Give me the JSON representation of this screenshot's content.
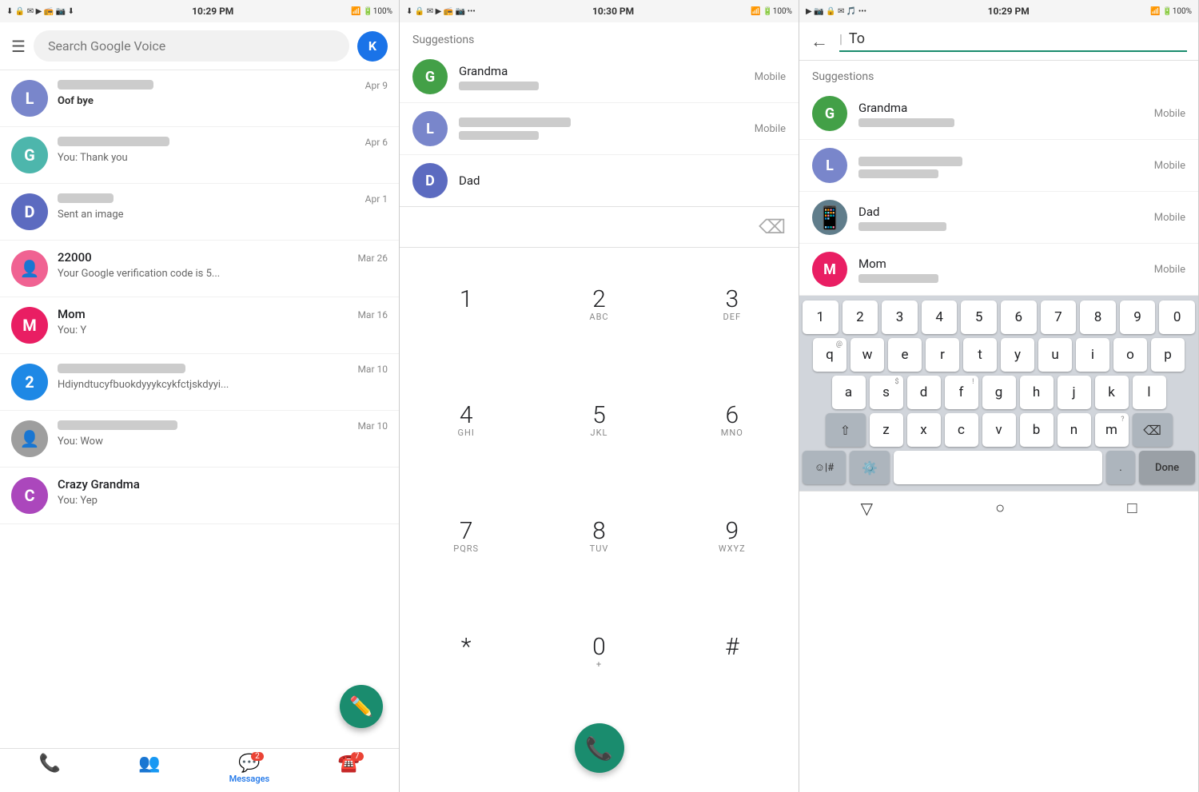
{
  "panel1": {
    "status": {
      "time": "10:29 PM",
      "battery": "100%"
    },
    "search_placeholder": "Search Google Voice",
    "avatar_label": "K",
    "conversations": [
      {
        "id": "L",
        "color": "#7986cb",
        "name": "Oof bye",
        "name_bold": true,
        "preview": "Oof bye",
        "date": "Apr 9",
        "preview_blurred": true,
        "preview_text": ""
      },
      {
        "id": "G",
        "color": "#4db6ac",
        "name": "",
        "name_bold": false,
        "preview": "You: Thank you",
        "date": "Apr 6",
        "preview_blurred": false,
        "name_blurred": true
      },
      {
        "id": "D",
        "color": "#5c6bc0",
        "name": "",
        "name_bold": false,
        "preview": "Sent an image",
        "date": "Apr 1",
        "name_blurred": true
      },
      {
        "id": "!",
        "color": "#e91e63",
        "name": "22000",
        "name_bold": false,
        "preview": "Your Google verification code is 5...",
        "date": "Mar 26",
        "name_blurred": false,
        "icon": true
      },
      {
        "id": "M",
        "color": "#e91e63",
        "name": "Mom",
        "name_bold": false,
        "preview": "You: Y",
        "date": "Mar 16",
        "name_blurred": false
      },
      {
        "id": "2",
        "color": "#1e88e5",
        "name": "",
        "name_bold": false,
        "preview": "Hdiyndtucyfbuokdyyykcykfctjskdyyi...",
        "date": "Mar 10",
        "name_blurred": true
      },
      {
        "id": "!",
        "color": "#9e9e9e",
        "name": "",
        "name_bold": false,
        "preview": "You: Wow",
        "date": "Mar 10",
        "name_blurred": true,
        "icon": true
      },
      {
        "id": "C",
        "color": "#ab47bc",
        "name": "Crazy Grandma",
        "name_bold": false,
        "preview": "You: Yep",
        "date": "",
        "name_blurred": false
      }
    ],
    "nav": [
      {
        "label": "",
        "icon": "📞",
        "id": "calls",
        "badge": ""
      },
      {
        "label": "",
        "icon": "👥",
        "id": "contacts",
        "badge": ""
      },
      {
        "label": "Messages",
        "icon": "💬",
        "id": "messages",
        "active": true,
        "badge": "2"
      },
      {
        "label": "",
        "icon": "☎️",
        "id": "voicemail",
        "badge": "7"
      }
    ],
    "fab_label": "✏️"
  },
  "panel2": {
    "status": {
      "time": "10:30 PM",
      "battery": "100%"
    },
    "suggestions_title": "Suggestions",
    "suggestions": [
      {
        "id": "G",
        "color": "#43a047",
        "name": "Grandma",
        "type": "Mobile"
      },
      {
        "id": "L",
        "color": "#7986cb",
        "name": "",
        "type": "Mobile"
      },
      {
        "id": "D",
        "color": "#5c6bc0",
        "name": "Dad",
        "type": ""
      }
    ],
    "dialpad": [
      {
        "num": "1",
        "letters": ""
      },
      {
        "num": "2",
        "letters": "ABC"
      },
      {
        "num": "3",
        "letters": "DEF"
      },
      {
        "num": "4",
        "letters": "GHI"
      },
      {
        "num": "5",
        "letters": "JKL"
      },
      {
        "num": "6",
        "letters": "MNO"
      },
      {
        "num": "7",
        "letters": "PQRS"
      },
      {
        "num": "8",
        "letters": "TUV"
      },
      {
        "num": "9",
        "letters": "WXYZ"
      },
      {
        "num": "*",
        "letters": ""
      },
      {
        "num": "0",
        "letters": "+"
      },
      {
        "num": "#",
        "letters": ""
      }
    ],
    "call_icon": "📞"
  },
  "panel3": {
    "status": {
      "time": "10:29 PM",
      "battery": "100%"
    },
    "to_label": "To",
    "to_cursor": "|",
    "suggestions_title": "Suggestions",
    "suggestions": [
      {
        "id": "G",
        "color": "#43a047",
        "name": "Grandma",
        "type": "Mobile"
      },
      {
        "id": "L",
        "color": "#7986cb",
        "name": "",
        "type": "Mobile"
      },
      {
        "id": "D",
        "color": "#607d8b",
        "name": "Dad",
        "type": "Mobile",
        "has_image": true
      },
      {
        "id": "M",
        "color": "#e91e63",
        "name": "Mom",
        "type": "Mobile"
      }
    ],
    "keyboard": {
      "number_row": [
        "1",
        "2",
        "3",
        "4",
        "5",
        "6",
        "7",
        "8",
        "9",
        "0"
      ],
      "row1": [
        "q",
        "w",
        "e",
        "r",
        "t",
        "y",
        "u",
        "i",
        "o",
        "p"
      ],
      "row2": [
        "a",
        "s",
        "d",
        "f",
        "g",
        "h",
        "j",
        "k",
        "l"
      ],
      "row3": [
        "z",
        "x",
        "c",
        "v",
        "b",
        "n",
        "m"
      ],
      "hints": {
        "q": "@",
        "w": "",
        "e": "",
        "r": "",
        "t": "",
        "y": "",
        "u": "",
        "i": "",
        "o": "",
        "p": "",
        "a": "",
        "s": "$",
        "d": "",
        "f": "!",
        "g": "",
        "h": "",
        "j": "",
        "k": "",
        "l": "",
        "z": "",
        "x": "",
        "c": "",
        "v": "",
        "b": "",
        "n": "",
        "m": "?"
      }
    },
    "done_label": "Done",
    "nav": [
      "▽",
      "○",
      "□"
    ]
  }
}
